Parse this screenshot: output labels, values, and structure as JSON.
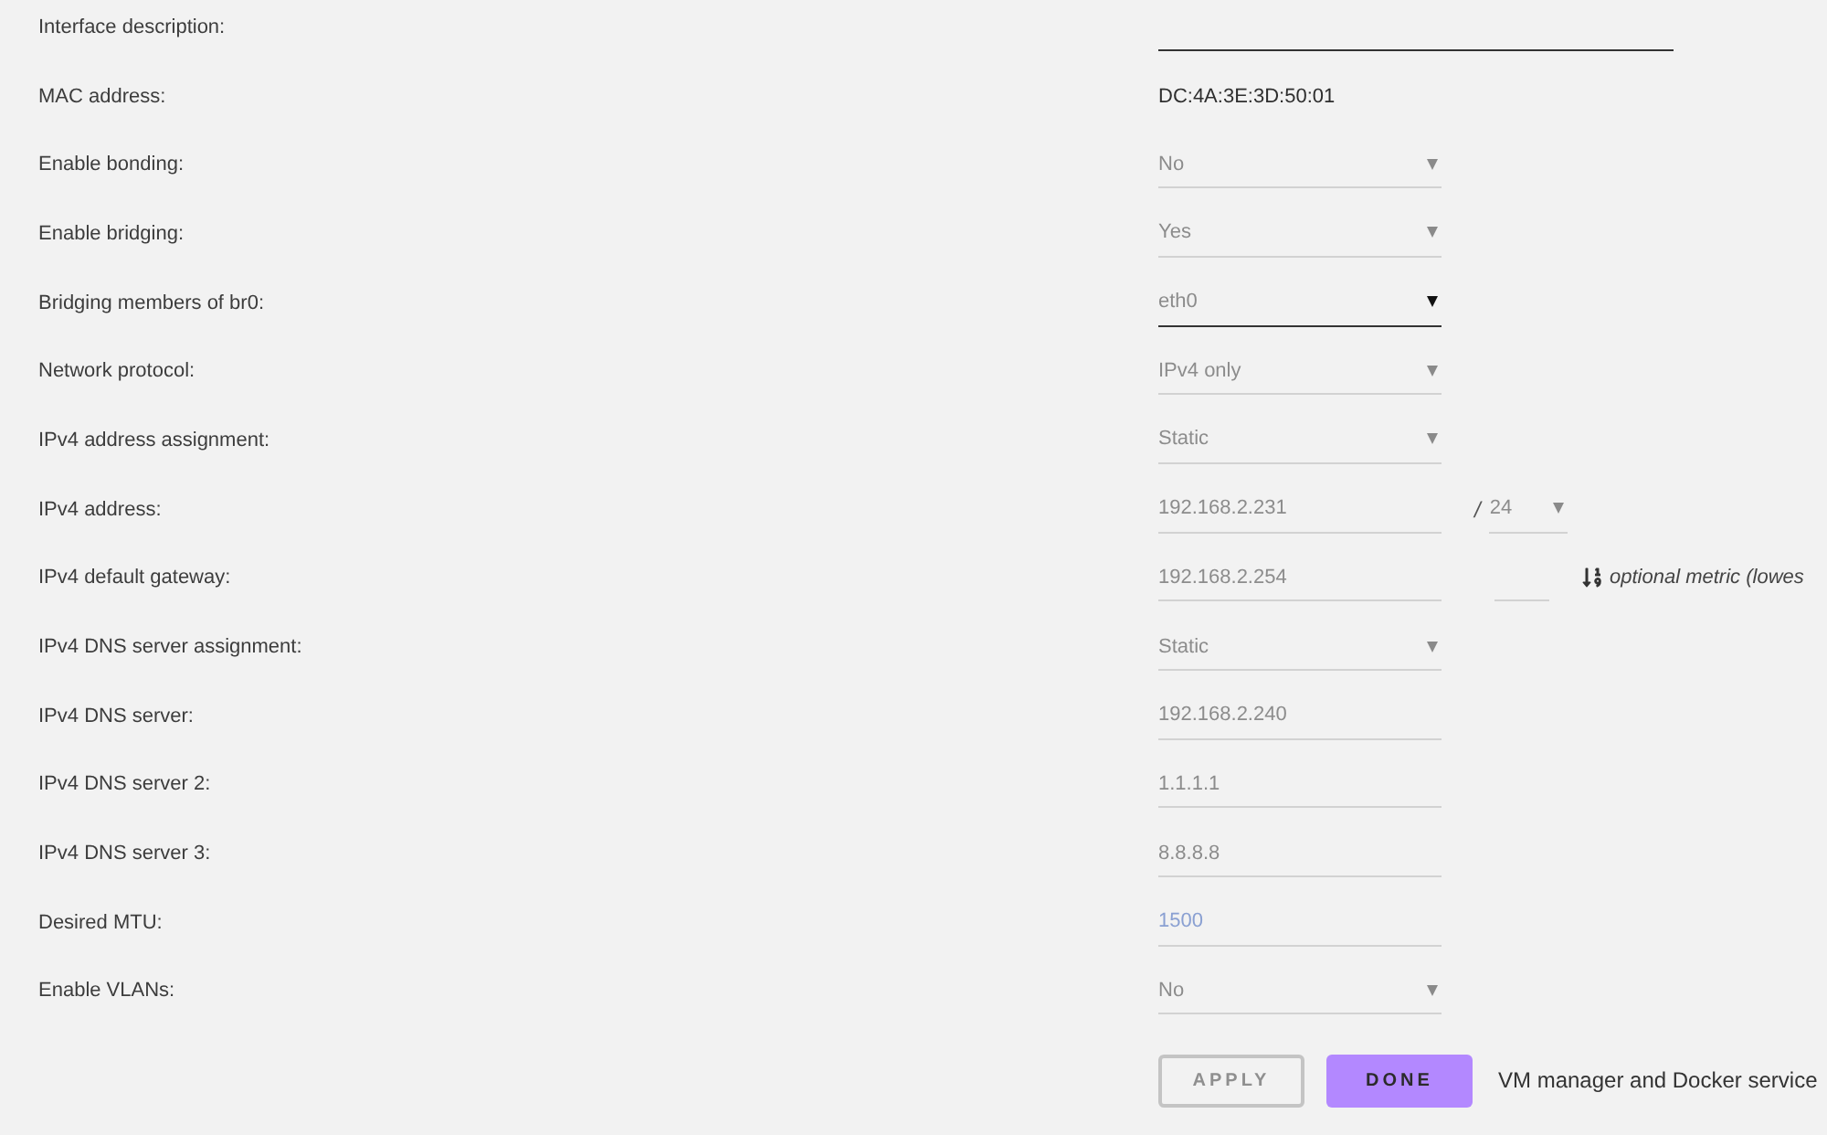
{
  "fields": [
    {
      "label": "Interface description:",
      "kind": "description",
      "disabled": false
    },
    {
      "label": "MAC address:",
      "kind": "text",
      "value": "DC:4A:3E:3D:50:01"
    },
    {
      "label": "Enable bonding:",
      "kind": "select",
      "value": "No",
      "disabled": true
    },
    {
      "label": "Enable bridging:",
      "kind": "select",
      "value": "Yes",
      "disabled": true
    },
    {
      "label": "Bridging members of br0:",
      "kind": "select",
      "value": "eth0",
      "disabled": false
    },
    {
      "label": "Network protocol:",
      "kind": "select",
      "value": "IPv4 only",
      "disabled": true
    },
    {
      "label": "IPv4 address assignment:",
      "kind": "select",
      "value": "Static",
      "disabled": true
    },
    {
      "label": "IPv4 address:",
      "kind": "address",
      "value": "192.168.2.231",
      "separator": "/",
      "prefix": "24",
      "disabled": true
    },
    {
      "label": "IPv4 default gateway:",
      "kind": "gateway",
      "value": "192.168.2.254",
      "hint": "optional metric (lowes",
      "disabled": true
    },
    {
      "label": "IPv4 DNS server assignment:",
      "kind": "select",
      "value": "Static",
      "disabled": true
    },
    {
      "label": "IPv4 DNS server:",
      "kind": "input",
      "value": "192.168.2.240",
      "disabled": true
    },
    {
      "label": "IPv4 DNS server 2:",
      "kind": "input",
      "value": "1.1.1.1",
      "disabled": true
    },
    {
      "label": "IPv4 DNS server 3:",
      "kind": "input",
      "value": "8.8.8.8",
      "disabled": true
    },
    {
      "label": "Desired MTU:",
      "kind": "input",
      "placeholder": "1500",
      "disabled": true
    },
    {
      "label": "Enable VLANs:",
      "kind": "select",
      "value": "No",
      "disabled": true
    }
  ],
  "buttons": [
    {
      "label": "APPLY",
      "disabled": true
    },
    {
      "label": "DONE",
      "disabled": false
    }
  ],
  "note": "VM manager and Docker service"
}
